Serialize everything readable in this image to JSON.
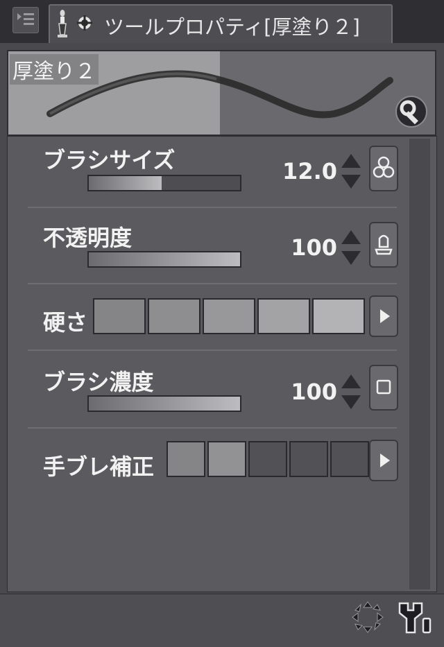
{
  "panel": {
    "title": "ツールプロパティ[厚塗り２]",
    "tool_name": "厚塗り２"
  },
  "properties": {
    "brush_size": {
      "label": "ブラシサイズ",
      "value": "12.0",
      "level": 0.48
    },
    "opacity": {
      "label": "不透明度",
      "value": "100",
      "level": 1.0
    },
    "hardness": {
      "label": "硬さ",
      "levels": 5,
      "selected": 5
    },
    "brush_density": {
      "label": "ブラシ濃度",
      "value": "100",
      "level": 1.0
    },
    "stabilization": {
      "label": "手ブレ補正",
      "levels": 5,
      "selected": 2
    }
  },
  "icons": {
    "menu": "panel-menu-icon",
    "tool": "brush-tool-icon",
    "settings": "wrench-icon",
    "size_pressure": "pressure-circles-icon",
    "opacity_pressure": "pressure-pen-icon",
    "density_toggle": "square-toggle-icon",
    "reset": "reset-icon",
    "sub_tool_detail": "sub-tool-detail-icon"
  },
  "colors": {
    "panel_bg": "#5b5b5f",
    "title_bar": "#2f2f33",
    "text": "#f2f2f2"
  }
}
